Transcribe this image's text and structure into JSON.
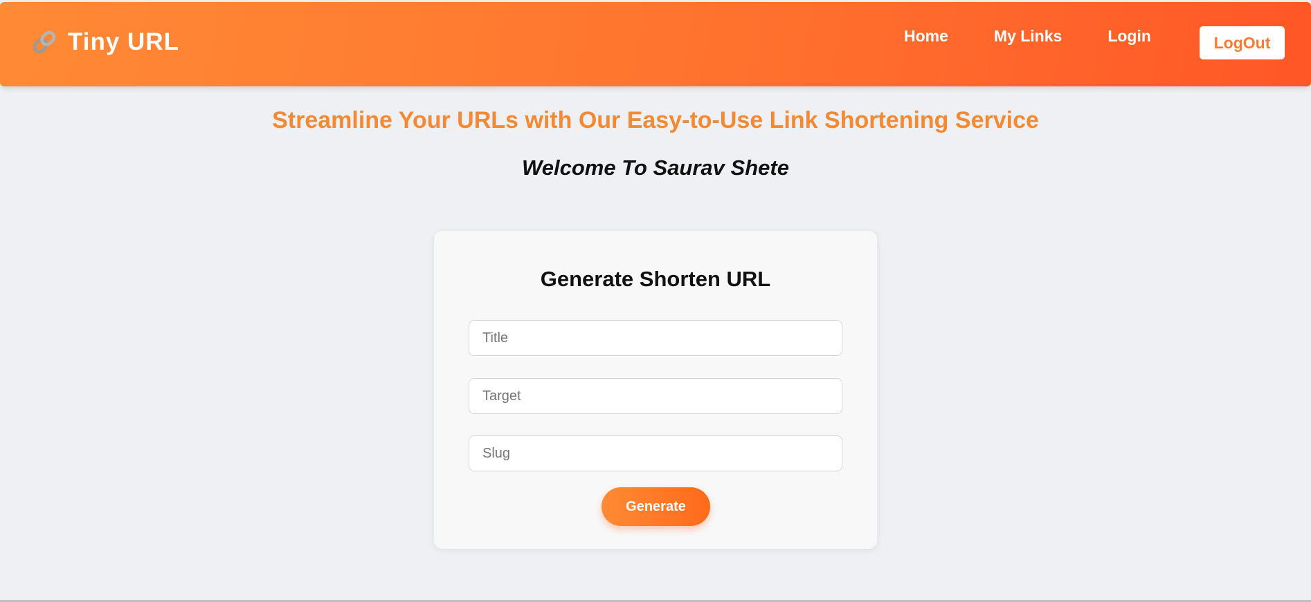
{
  "header": {
    "brand_icon": "link-icon",
    "brand_title": "Tiny URL",
    "nav": {
      "home": "Home",
      "my_links": "My Links",
      "login": "Login",
      "logout": "LogOut"
    }
  },
  "main": {
    "tagline": "Streamline Your URLs with Our Easy-to-Use Link Shortening Service",
    "welcome": "Welcome To Saurav Shete"
  },
  "form": {
    "title": "Generate Shorten URL",
    "title_field": {
      "placeholder": "Title",
      "value": ""
    },
    "target_field": {
      "placeholder": "Target",
      "value": ""
    },
    "slug_field": {
      "placeholder": "Slug",
      "value": ""
    },
    "submit_label": "Generate"
  },
  "colors": {
    "accent": "#ff7a30",
    "tagline": "#f28a35",
    "background": "#eef0f4",
    "card": "#f8f8f8"
  }
}
